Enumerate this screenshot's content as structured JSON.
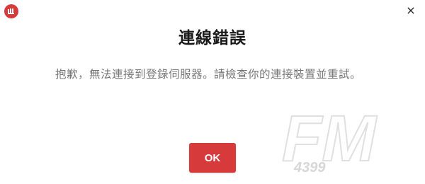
{
  "dialog": {
    "title": "連線錯誤",
    "message": "抱歉，無法連接到登錄伺服器。請檢查你的連接裝置並重試。",
    "ok_label": "OK",
    "close_glyph": "×"
  },
  "watermark": {
    "logo_text": "FM",
    "number_text": "4399"
  },
  "icons": {
    "app": "app-logo-icon",
    "close": "close-icon"
  },
  "colors": {
    "accent": "#d63a3a",
    "title": "#1a1a1a",
    "message": "#777777",
    "background": "#ffffff"
  }
}
